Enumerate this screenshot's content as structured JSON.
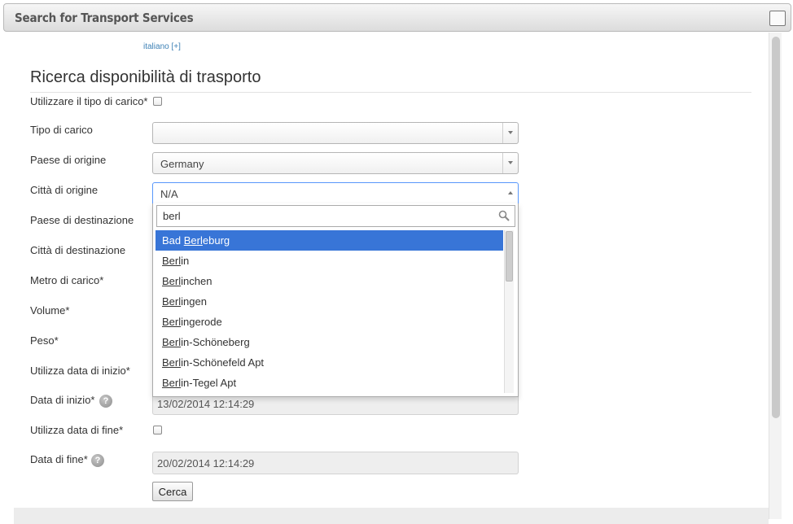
{
  "window": {
    "title": "Search for Transport Services"
  },
  "language": {
    "label": "italiano [+]"
  },
  "page_title": "Ricerca disponibilità di trasporto",
  "form": {
    "use_load_type_label": "Utilizzare il tipo di carico*",
    "load_type_label": "Tipo di carico",
    "load_type_value": "",
    "origin_country_label": "Paese di origine",
    "origin_country_value": "Germany",
    "origin_city_label": "Città di origine",
    "origin_city_value": "N/A",
    "dest_country_label": "Paese di destinazione",
    "dest_city_label": "Città di destinazione",
    "load_meter_label": "Metro di carico*",
    "volume_label": "Volume*",
    "weight_label": "Peso*",
    "use_start_date_label": "Utilizza data di inizio*",
    "start_date_label": "Data di inizio*",
    "start_date_value": "13/02/2014 12:14:29",
    "use_end_date_label": "Utilizza data di fine*",
    "end_date_label": "Data di fine*",
    "end_date_value": "20/02/2014 12:14:29",
    "search_button": "Cerca"
  },
  "city_dropdown": {
    "search_value": "berl",
    "results": [
      {
        "pre": "Bad ",
        "match": "Berl",
        "post": "eburg",
        "highlighted": true
      },
      {
        "pre": "",
        "match": "Berl",
        "post": "in",
        "highlighted": false
      },
      {
        "pre": "",
        "match": "Berl",
        "post": "inchen",
        "highlighted": false
      },
      {
        "pre": "",
        "match": "Berl",
        "post": "ingen",
        "highlighted": false
      },
      {
        "pre": "",
        "match": "Berl",
        "post": "ingerode",
        "highlighted": false
      },
      {
        "pre": "",
        "match": "Berl",
        "post": "in-Schöneberg",
        "highlighted": false
      },
      {
        "pre": "",
        "match": "Berl",
        "post": "in-Schönefeld Apt",
        "highlighted": false
      },
      {
        "pre": "",
        "match": "Berl",
        "post": "in-Tegel Apt",
        "highlighted": false
      }
    ]
  },
  "colors": {
    "highlight": "#3875d7",
    "link": "#3c80b5",
    "focus_border": "#5897fb"
  },
  "icons": {
    "help": "question-mark-circle",
    "search": "magnifier",
    "dropdown": "triangle-down"
  }
}
